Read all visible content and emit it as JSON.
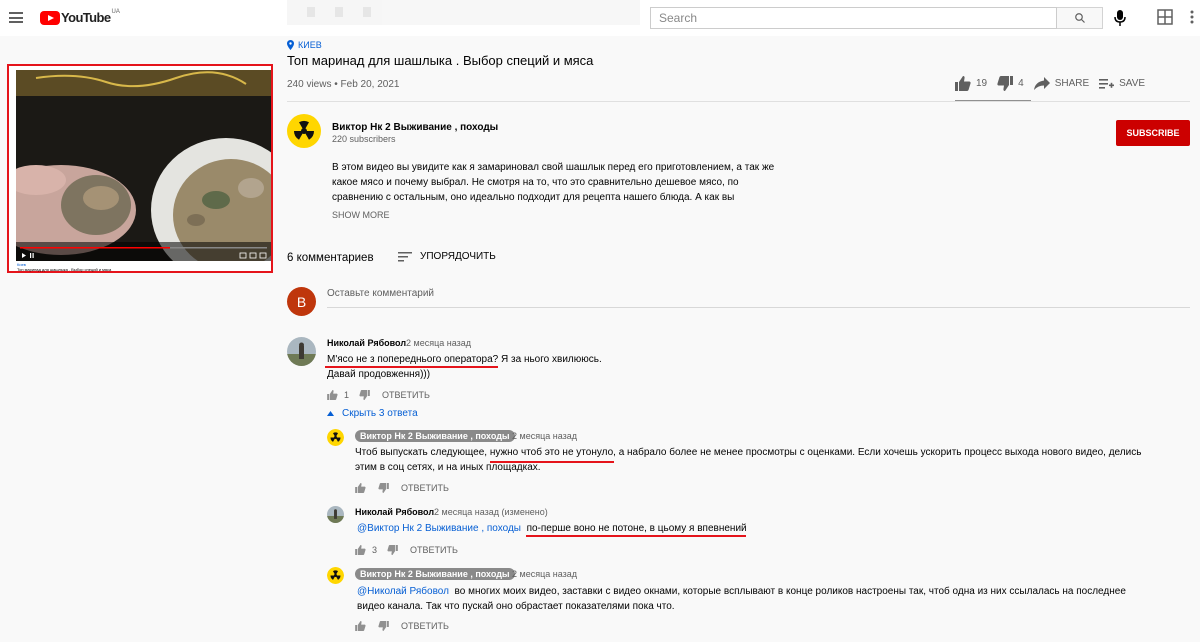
{
  "header": {
    "logo_text": "YouTube",
    "logo_country": "UA",
    "search_placeholder": "Search"
  },
  "mini_player": {
    "location": "Киев",
    "title": "Топ маринад для шашлыка . Выбор специй и мяса"
  },
  "video": {
    "location": "КИЕВ",
    "title": "Топ маринад для шашлыка . Выбор специй и мяса",
    "views_date": "240 views • Feb 20, 2021",
    "likes": "19",
    "dislikes": "4",
    "share_label": "SHARE",
    "save_label": "SAVE",
    "channel_name": "Виктор Нк 2 Выживание , походы",
    "subscribers": "220 subscribers",
    "subscribe_label": "SUBSCRIBE",
    "description": "В этом видео вы увидите как я замариновал свой шашлык перед его приготовлением, а так же какое мясо и почему выбрал. Не смотря на то, что это сравнительно дешевое мясо, по сравнению с остальным, оно идеально подходит для рецепта нашего блюда. А как вы",
    "show_more_label": "SHOW MORE"
  },
  "comments_section": {
    "count_label": "6 комментариев",
    "sort_label": "УПОРЯДОЧИТЬ",
    "my_avatar_letter": "B",
    "add_comment_placeholder": "Оставьте комментарий",
    "hide_replies_label": "Скрыть 3 ответа",
    "reply_label": "ОТВЕТИТЬ"
  },
  "comments": [
    {
      "author": "Николай Рябовол",
      "time": "2 месяца назад",
      "text_line1": "М'ясо не з попереднього оператора? Я за нього хвилююсь.",
      "text_line2": "Давай продовження)))",
      "likes": "1"
    },
    {
      "author": "Виктор Нк 2 Выживание , походы",
      "time": "2 месяца назад",
      "text": "Чтоб выпускать следующее, нужно чтоб это не утонуло, а набрало более не менее просмотры с оценками. Если хочешь ускорить процесс выхода нового видео, делись этим в соц сетях, и на иных площадках.",
      "likes": ""
    },
    {
      "author": "Николай Рябовол",
      "time": "2 месяца назад (изменено)",
      "mention": "@Виктор Нк 2 Выживание , походы",
      "text": "по-перше воно не потоне, в цьому я впевнений",
      "likes": "3"
    },
    {
      "author": "Виктор Нк 2 Выживание , походы",
      "time": "2 месяца назад",
      "mention": "@Николай Рябовол",
      "text": "во многих моих видео, заставки с видео окнами, которые всплывают в конце роликов  настроены так, чтоб одна из них ссылалась на последнее видео канала. Так что пускай оно обрастает показателями пока что.",
      "likes": ""
    }
  ],
  "colors": {
    "accent_red": "#e5141b",
    "subscribe_red": "#cc0000",
    "link_blue": "#065fd4"
  },
  "icons": [
    "menu-icon",
    "youtube-logo-icon",
    "search-icon",
    "mic-icon",
    "apps-icon",
    "more-icon",
    "location-pin-icon",
    "thumbs-up-icon",
    "thumbs-down-icon",
    "share-icon",
    "save-playlist-icon",
    "sort-icon",
    "chevron-up-icon",
    "radiation-avatar-icon"
  ]
}
